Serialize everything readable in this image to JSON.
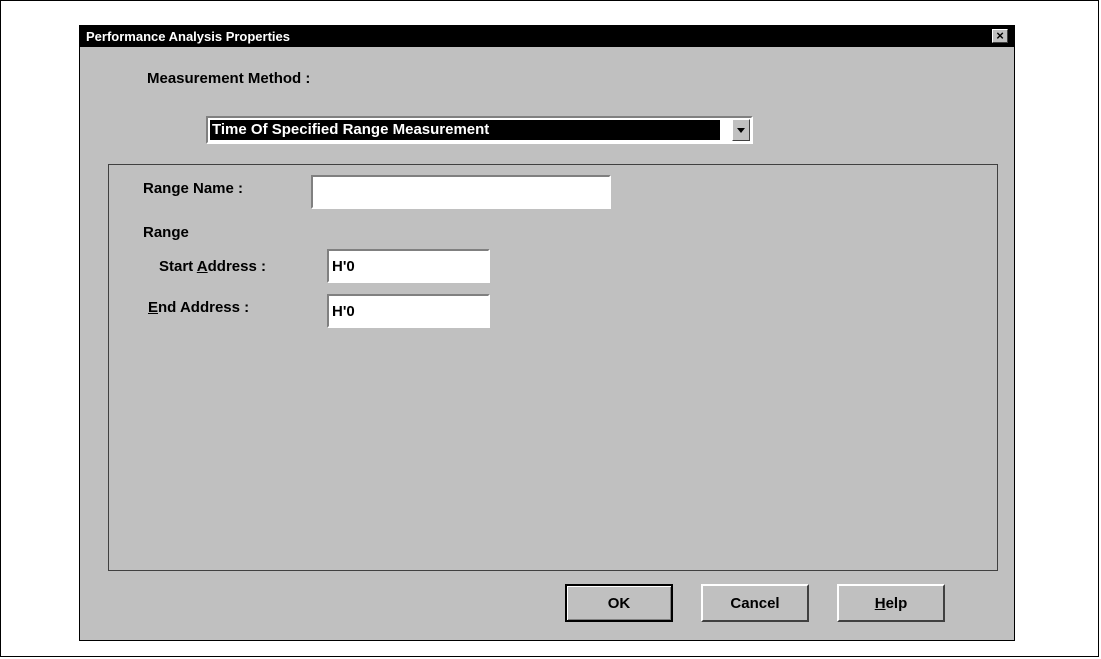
{
  "dialog": {
    "title": "Performance Analysis Properties",
    "close_glyph": "×"
  },
  "measurement": {
    "label": "Measurement Method :",
    "selected": "Time Of Specified Range Measurement"
  },
  "range_name": {
    "label": "Range Name :",
    "value": ""
  },
  "range": {
    "label": "Range",
    "start": {
      "prefix": "Start ",
      "accel": "A",
      "suffix": "ddress :",
      "value": "H'0"
    },
    "end": {
      "accel": "E",
      "suffix": "nd Address :",
      "value": "H'0"
    }
  },
  "buttons": {
    "ok": "OK",
    "cancel": "Cancel",
    "help_accel": "H",
    "help_rest": "elp"
  },
  "colors": {
    "dialog_bg": "#c0c0c0",
    "titlebar_bg": "#000000",
    "highlight": "#000000"
  }
}
